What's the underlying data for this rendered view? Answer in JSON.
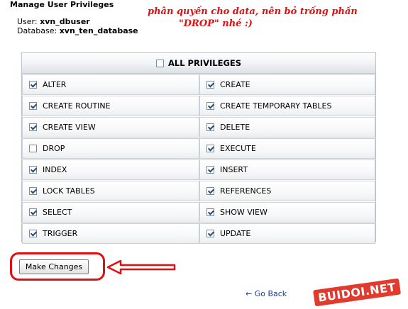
{
  "page": {
    "title": "Manage User Privileges",
    "user_label": "User:",
    "user_value": "xvn_dbuser",
    "database_label": "Database:",
    "database_value": "xvn_ten_database"
  },
  "annotation": {
    "line1": "phân quyền cho data, nên bỏ trống phần",
    "line2": "\"DROP\"  nhé :)",
    "color": "#e01010"
  },
  "privileges": {
    "all_label": "ALL PRIVILEGES",
    "all_checked": false,
    "items": [
      {
        "label": "ALTER",
        "checked": true
      },
      {
        "label": "CREATE",
        "checked": true
      },
      {
        "label": "CREATE ROUTINE",
        "checked": true
      },
      {
        "label": "CREATE TEMPORARY TABLES",
        "checked": true
      },
      {
        "label": "CREATE VIEW",
        "checked": true
      },
      {
        "label": "DELETE",
        "checked": true
      },
      {
        "label": "DROP",
        "checked": false
      },
      {
        "label": "EXECUTE",
        "checked": true
      },
      {
        "label": "INDEX",
        "checked": true
      },
      {
        "label": "INSERT",
        "checked": true
      },
      {
        "label": "LOCK TABLES",
        "checked": true
      },
      {
        "label": "REFERENCES",
        "checked": true
      },
      {
        "label": "SELECT",
        "checked": true
      },
      {
        "label": "SHOW VIEW",
        "checked": true
      },
      {
        "label": "TRIGGER",
        "checked": true
      },
      {
        "label": "UPDATE",
        "checked": true
      }
    ]
  },
  "actions": {
    "make_changes_label": "Make Changes",
    "go_back_label": "← Go Back"
  },
  "watermark": {
    "text": "BUIDOI.NET",
    "color": "#e23b2e"
  }
}
